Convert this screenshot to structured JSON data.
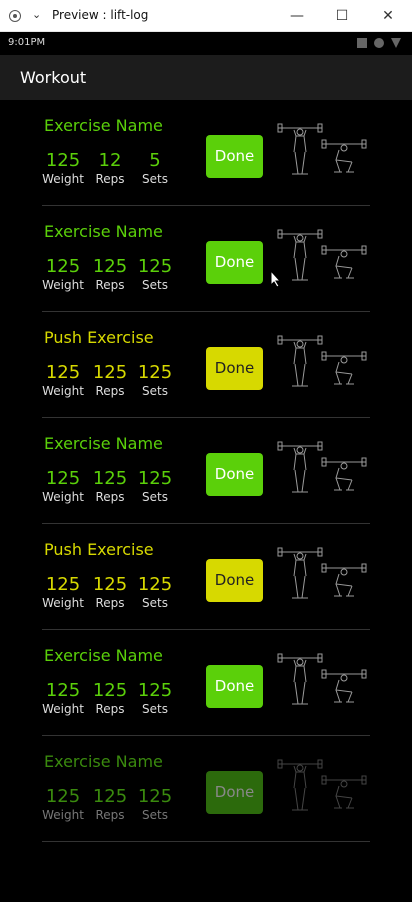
{
  "window": {
    "title": "Preview : lift-log"
  },
  "status": {
    "time": "9:01PM"
  },
  "appbar": {
    "title": "Workout"
  },
  "cards": [
    {
      "name": "Exercise Name",
      "weight": "125",
      "reps": "12",
      "sets": "5",
      "variant": "green"
    },
    {
      "name": "Exercise Name",
      "weight": "125",
      "reps": "125",
      "sets": "125",
      "variant": "green"
    },
    {
      "name": "Push Exercise",
      "weight": "125",
      "reps": "125",
      "sets": "125",
      "variant": "yellow"
    },
    {
      "name": "Exercise Name",
      "weight": "125",
      "reps": "125",
      "sets": "125",
      "variant": "green"
    },
    {
      "name": "Push Exercise",
      "weight": "125",
      "reps": "125",
      "sets": "125",
      "variant": "yellow"
    },
    {
      "name": "Exercise Name",
      "weight": "125",
      "reps": "125",
      "sets": "125",
      "variant": "green"
    },
    {
      "name": "Exercise Name",
      "weight": "125",
      "reps": "125",
      "sets": "125",
      "variant": "faded"
    }
  ],
  "labels": {
    "weight": "Weight",
    "reps": "Reps",
    "sets": "Sets",
    "done": "Done"
  }
}
